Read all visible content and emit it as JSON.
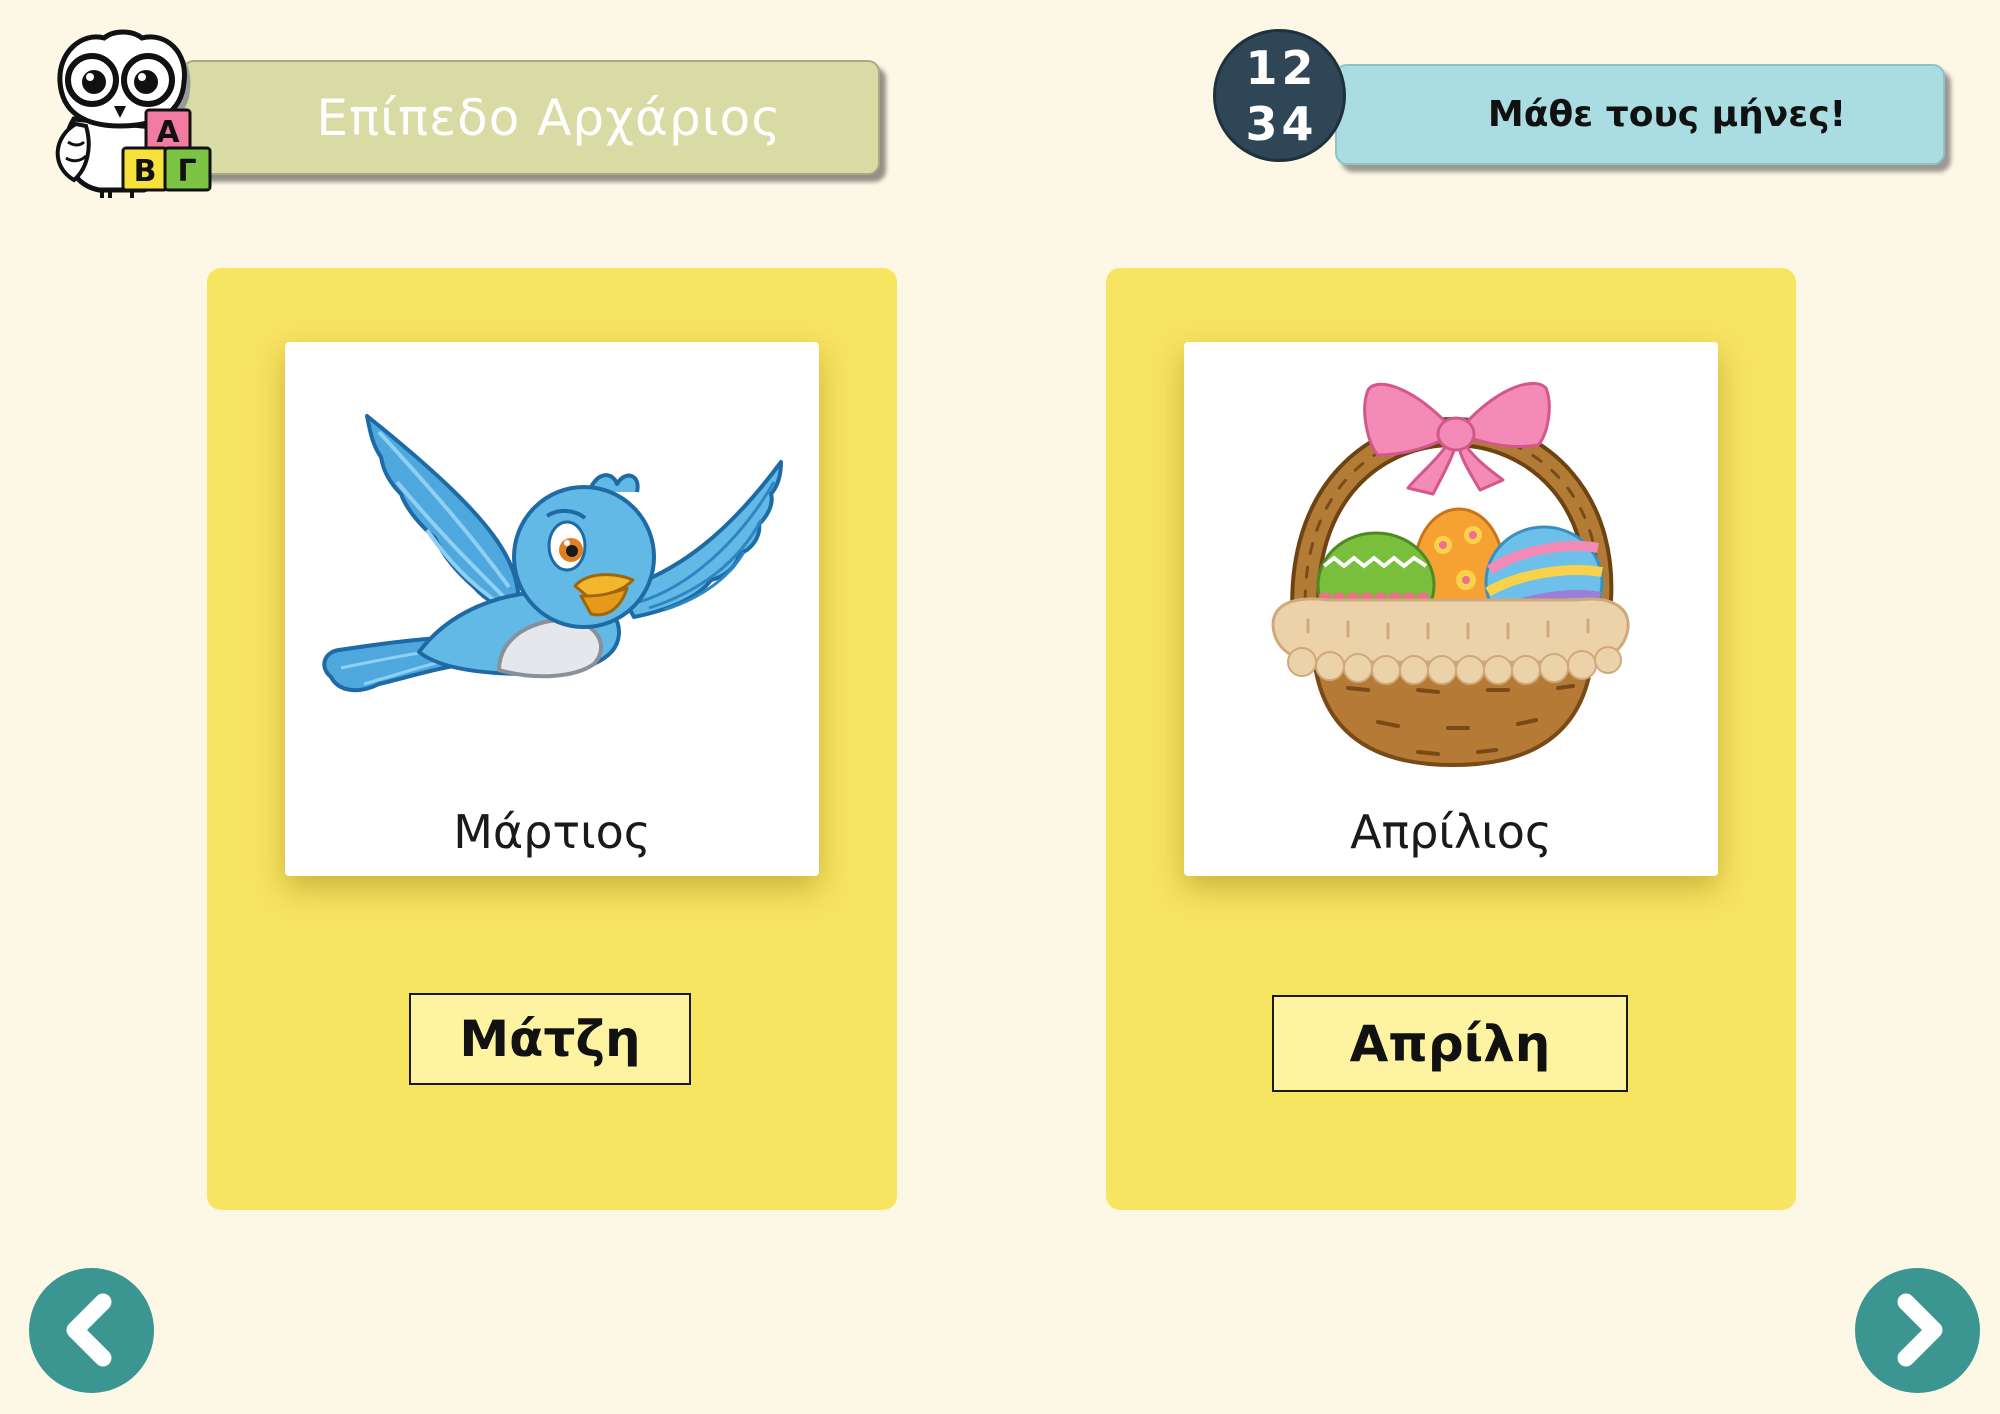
{
  "header": {
    "logo_icon": "owl-abc-blocks-logo-icon",
    "logo_blocks": [
      "Α",
      "Β",
      "Γ"
    ],
    "level_label": "Επίπεδο Αρχάριος",
    "number_badge_icon": "numbers-badge-icon",
    "number_badge_digits": [
      "1",
      "2",
      "3",
      "4"
    ],
    "title": "Μάθε τους μήνες!"
  },
  "cards": [
    {
      "image_icon": "bluebird-icon",
      "month": "Μάρτιος",
      "answer": "Μάτζη"
    },
    {
      "image_icon": "easter-basket-icon",
      "month": "Απρίλιος",
      "answer": "Απρίλη"
    }
  ],
  "navigation": {
    "prev_icon": "chevron-left-icon",
    "next_icon": "chevron-right-icon"
  },
  "colors": {
    "background": "#fdf7e6",
    "level_banner": "#d9dba4",
    "title_banner": "#a9dde1",
    "number_badge": "#2e4655",
    "card": "#f7e461",
    "answer_button": "#fdf3a0",
    "nav_button": "#3b9591"
  }
}
